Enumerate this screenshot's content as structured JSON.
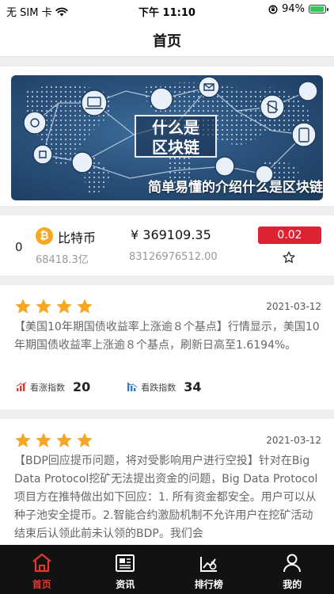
{
  "status_bar": {
    "carrier": "无 SIM 卡",
    "time": "下午 11:10",
    "battery": "94%",
    "battery_level": 0.94
  },
  "nav": {
    "title": "首页"
  },
  "banner": {
    "center_title_line1": "什么是",
    "center_title_line2": "区块链",
    "caption": "简单易懂的介绍什么是区块链"
  },
  "coin": {
    "rank": "0",
    "icon_glyph": "₿",
    "name": "比特币",
    "market_cap": "68418.3亿",
    "price": "¥ 369109.35",
    "volume": "83126976512.00",
    "change": "0.02",
    "colors": {
      "change_bg": "#dd2233",
      "icon": "#f7a823"
    }
  },
  "news": [
    {
      "rating": 4,
      "date": "2021-03-12",
      "body": "【美国10年期国债收益率上涨逾８个基点】行情显示，美国10年期国债收益率上涨逾８个基点，刷新日高至1.6194%。",
      "bull_label": "看涨指数",
      "bull_value": "20",
      "bear_label": "看跌指数",
      "bear_value": "34"
    },
    {
      "rating": 4,
      "date": "2021-03-12",
      "body": "【BDP回应提币问题，将对受影响用户进行空投】针对在Big Data Protocol挖矿无法提出资金的问题，Big Data Protocol项目方在推特做出如下回应：1. 所有资金都安全。用户可以从种子池安全提币。2.智能合约激励机制不允许用户在挖矿活动结束后认领此前未认领的BDP。我们会"
    }
  ],
  "tabs": [
    {
      "label": "首页",
      "icon": "home-icon",
      "active": true
    },
    {
      "label": "资讯",
      "icon": "newspaper-icon",
      "active": false
    },
    {
      "label": "排行榜",
      "icon": "ranking-icon",
      "active": false
    },
    {
      "label": "我的",
      "icon": "user-icon",
      "active": false
    }
  ],
  "colors": {
    "accent": "#e23a2e",
    "star": "#f5a623",
    "tabbar_bg": "#121212"
  }
}
